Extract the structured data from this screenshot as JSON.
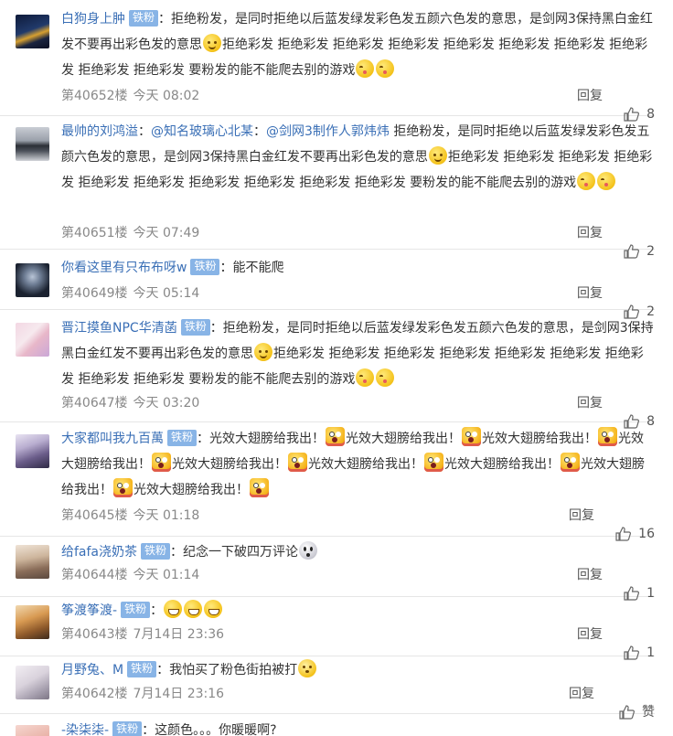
{
  "labels": {
    "reply": "回复",
    "badge": "铁粉",
    "colon": "："
  },
  "comments": [
    {
      "user": "白狗身上肿",
      "badge": "铁粉",
      "text_parts": [
        "拒绝粉发，是同时拒绝以后蓝发绿发彩色发五颜六色发的意思，是剑网3保持黑白金红发不要再出彩色发的意思",
        "拒绝彩发 拒绝彩发 拒绝彩发 拒绝彩发 拒绝彩发 拒绝彩发 拒绝彩发 拒绝彩发 拒绝彩发 拒绝彩发 要粉发的能不能爬去别的游戏"
      ],
      "floor": "第40652楼",
      "time": "今天 08:02",
      "likes": "8"
    },
    {
      "user": "最帅的刘鸿溢",
      "badge": "",
      "mentions": [
        "@知名玻璃心北某",
        "@剑网3制作人郭炜炜"
      ],
      "text_parts": [
        "拒绝粉发，是同时拒绝以后蓝发绿发彩色发五颜六色发的意思，是剑网3保持黑白金红发不要再出彩色发的意思",
        "拒绝彩发 拒绝彩发 拒绝彩发 拒绝彩发 拒绝彩发 拒绝彩发 拒绝彩发 拒绝彩发 拒绝彩发 拒绝彩发 要粉发的能不能爬去别的游戏"
      ],
      "floor": "第40651楼",
      "time": "今天 07:49",
      "likes": "2"
    },
    {
      "user": "你看这里有只布布呀w",
      "badge": "铁粉",
      "text_parts": [
        "能不能爬"
      ],
      "floor": "第40649楼",
      "time": "今天 05:14",
      "likes": "2"
    },
    {
      "user": "晋江摸鱼NPC华清菡",
      "badge": "铁粉",
      "text_parts": [
        "拒绝粉发，是同时拒绝以后蓝发绿发彩色发五颜六色发的意思，是剑网3保持黑白金红发不要再出彩色发的意思",
        "拒绝彩发 拒绝彩发 拒绝彩发 拒绝彩发 拒绝彩发 拒绝彩发 拒绝彩发 拒绝彩发 拒绝彩发 要粉发的能不能爬去别的游戏"
      ],
      "floor": "第40647楼",
      "time": "今天 03:20",
      "likes": "8"
    },
    {
      "user": "大家都叫我九百萬",
      "badge": "铁粉",
      "text_parts": [
        "光效大翅膀给我出！",
        "光效大翅膀给我出！",
        "光效大翅膀给我出！",
        "光效大翅膀给我出！",
        "光效大翅膀给我出！",
        "光效大翅膀给我出！",
        "光效大翅膀给我出！",
        "光效大翅膀给我出！",
        "光效大翅膀给我出！"
      ],
      "floor": "第40645楼",
      "time": "今天 01:18",
      "likes": "16"
    },
    {
      "user": "给fafa浇奶茶",
      "badge": "铁粉",
      "text_parts": [
        "纪念一下破四万评论"
      ],
      "floor": "第40644楼",
      "time": "今天 01:14",
      "likes": "1"
    },
    {
      "user": "筝渡筝渡-",
      "badge": "铁粉",
      "text_parts": [
        ""
      ],
      "floor": "第40643楼",
      "time": "7月14日 23:36",
      "likes": "1"
    },
    {
      "user": "月野兔、M",
      "badge": "铁粉",
      "text_parts": [
        "我怕买了粉色街拍被打"
      ],
      "floor": "第40642楼",
      "time": "7月14日 23:16",
      "likes": "赞"
    },
    {
      "user": "-染柒柒-",
      "badge": "铁粉",
      "text_parts": [
        "这颜色。。。你暖暖啊?"
      ],
      "floor": "",
      "time": "",
      "likes": ""
    }
  ],
  "icons": {
    "like": "thumbs-up-icon",
    "emoji": "emoji-icon"
  },
  "colors": {
    "username": "#3a6fb6",
    "badge_bg": "#88b4e6",
    "meta": "#888888",
    "divider": "#e6e6e6"
  }
}
